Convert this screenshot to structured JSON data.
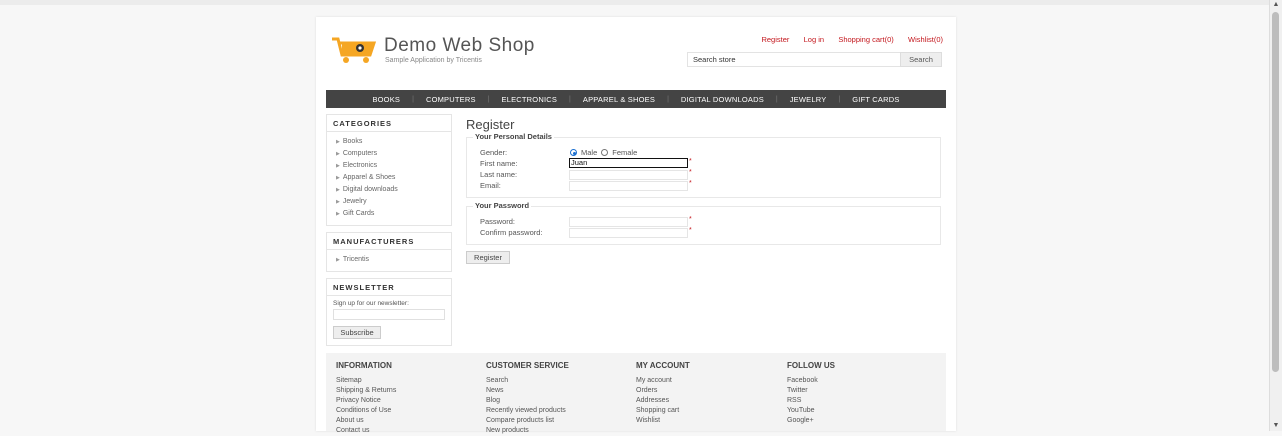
{
  "logo": {
    "title": "Demo Web Shop",
    "subtitle": "Sample Application by Tricentis"
  },
  "header_links": [
    "Register",
    "Log in",
    "Shopping cart(0)",
    "Wishlist(0)"
  ],
  "search": {
    "value": "Search store",
    "button": "Search"
  },
  "nav": [
    "BOOKS",
    "COMPUTERS",
    "ELECTRONICS",
    "APPAREL & SHOES",
    "DIGITAL DOWNLOADS",
    "JEWELRY",
    "GIFT CARDS"
  ],
  "categories": {
    "title": "CATEGORIES",
    "items": [
      "Books",
      "Computers",
      "Electronics",
      "Apparel & Shoes",
      "Digital downloads",
      "Jewelry",
      "Gift Cards"
    ]
  },
  "manufacturers": {
    "title": "MANUFACTURERS",
    "items": [
      "Tricentis"
    ]
  },
  "newsletter": {
    "title": "NEWSLETTER",
    "text": "Sign up for our newsletter:",
    "button": "Subscribe"
  },
  "form": {
    "title": "Register",
    "personal": {
      "legend": "Your Personal Details",
      "gender_label": "Gender:",
      "male": "Male",
      "female": "Female",
      "first_name_label": "First name:",
      "first_name_value": "Juan",
      "last_name_label": "Last name:",
      "email_label": "Email:"
    },
    "password": {
      "legend": "Your Password",
      "password_label": "Password:",
      "confirm_label": "Confirm password:"
    },
    "required_mark": "*",
    "submit": "Register"
  },
  "footer": {
    "information": {
      "title": "INFORMATION",
      "links": [
        "Sitemap",
        "Shipping & Returns",
        "Privacy Notice",
        "Conditions of Use",
        "About us",
        "Contact us"
      ]
    },
    "customer_service": {
      "title": "CUSTOMER SERVICE",
      "links": [
        "Search",
        "News",
        "Blog",
        "Recently viewed products",
        "Compare products list",
        "New products"
      ]
    },
    "my_account": {
      "title": "MY ACCOUNT",
      "links": [
        "My account",
        "Orders",
        "Addresses",
        "Shopping cart",
        "Wishlist"
      ]
    },
    "follow_us": {
      "title": "FOLLOW US",
      "links": [
        "Facebook",
        "Twitter",
        "RSS",
        "YouTube",
        "Google+"
      ]
    }
  },
  "colors": {
    "accent": "#c3161c",
    "nav_bg": "#444444",
    "logo_orange": "#f5a623"
  }
}
